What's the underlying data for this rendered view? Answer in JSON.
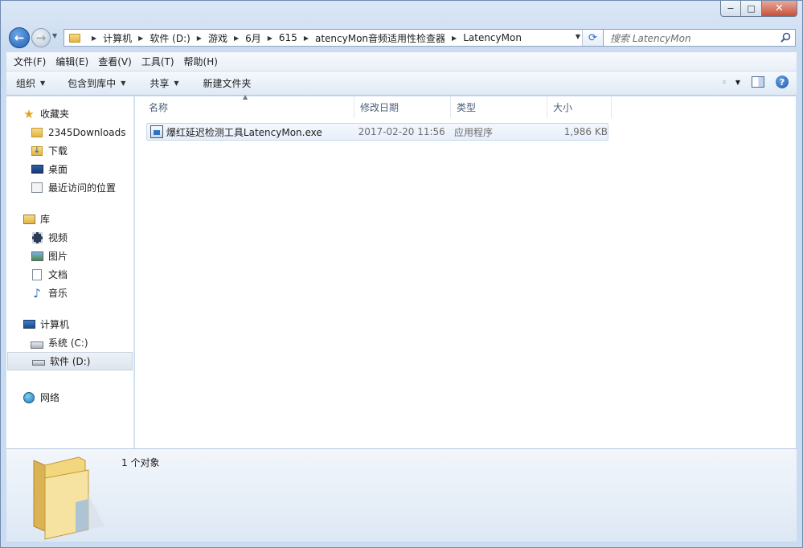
{
  "window": {
    "minimize_glyph": "−",
    "maximize_glyph": "□",
    "close_glyph": "✕"
  },
  "address": {
    "breadcrumbs": [
      "计算机",
      "软件 (D:)",
      "游戏",
      "6月",
      "615",
      "atencyMon音频适用性检查器",
      "LatencyMon"
    ],
    "search_placeholder": "搜索 LatencyMon"
  },
  "menubar": {
    "items": [
      "文件(F)",
      "编辑(E)",
      "查看(V)",
      "工具(T)",
      "帮助(H)"
    ]
  },
  "commandbar": {
    "organize": "组织",
    "include_in_library": "包含到库中",
    "share": "共享",
    "new_folder": "新建文件夹"
  },
  "navigation": {
    "favorites": {
      "label": "收藏夹",
      "items": [
        "2345Downloads",
        "下载",
        "桌面",
        "最近访问的位置"
      ]
    },
    "libraries": {
      "label": "库",
      "items": [
        "视频",
        "图片",
        "文档",
        "音乐"
      ]
    },
    "computer": {
      "label": "计算机",
      "items": [
        "系统 (C:)",
        "软件 (D:)"
      ]
    },
    "network": {
      "label": "网络"
    }
  },
  "files": {
    "columns": [
      "名称",
      "修改日期",
      "类型",
      "大小"
    ],
    "rows": [
      {
        "name": "爆红延迟检测工具LatencyMon.exe",
        "modified": "2017-02-20 11:56",
        "type": "应用程序",
        "size": "1,986 KB"
      }
    ]
  },
  "details": {
    "status": "1 个对象"
  },
  "icons": {
    "back": "back-arrow-icon",
    "forward": "forward-arrow-icon",
    "refresh": "refresh-icon",
    "search": "search-icon",
    "help": "help-icon"
  }
}
